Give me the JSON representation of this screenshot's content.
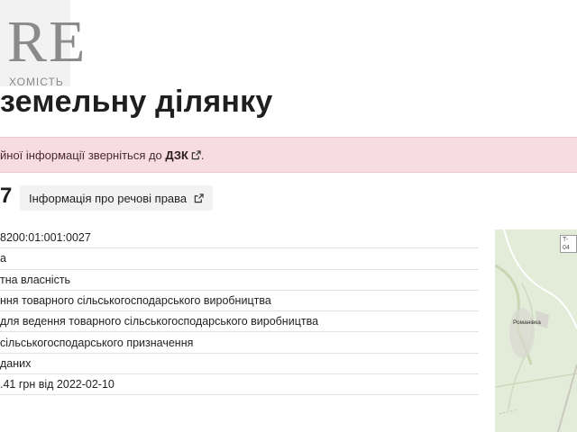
{
  "logo": {
    "mark": "RE",
    "sub": "ХОМІСТЬ"
  },
  "page_title": "земельну ділянку",
  "alert": {
    "text": "йної інформації зверніться до",
    "link": "ДЗК",
    "end": "."
  },
  "cadastral": {
    "suffix": "7",
    "rights_button": "Інформація про речові права"
  },
  "info_rows": [
    "8200:01:001:0027",
    "а",
    "тна власність",
    "ння товарного сільськогосподарського виробництва",
    "для ведення товарного сільськогосподарського виробництва",
    "сільськогосподарського призначення",
    " даних",
    ".41 грн від 2022-02-10"
  ],
  "map": {
    "road_label": "T-04",
    "place_label": "Романівка"
  },
  "colors": {
    "alert_bg": "#f7dde2",
    "button_bg": "#f2f2f2",
    "map_bg": "#e3ecd9"
  }
}
